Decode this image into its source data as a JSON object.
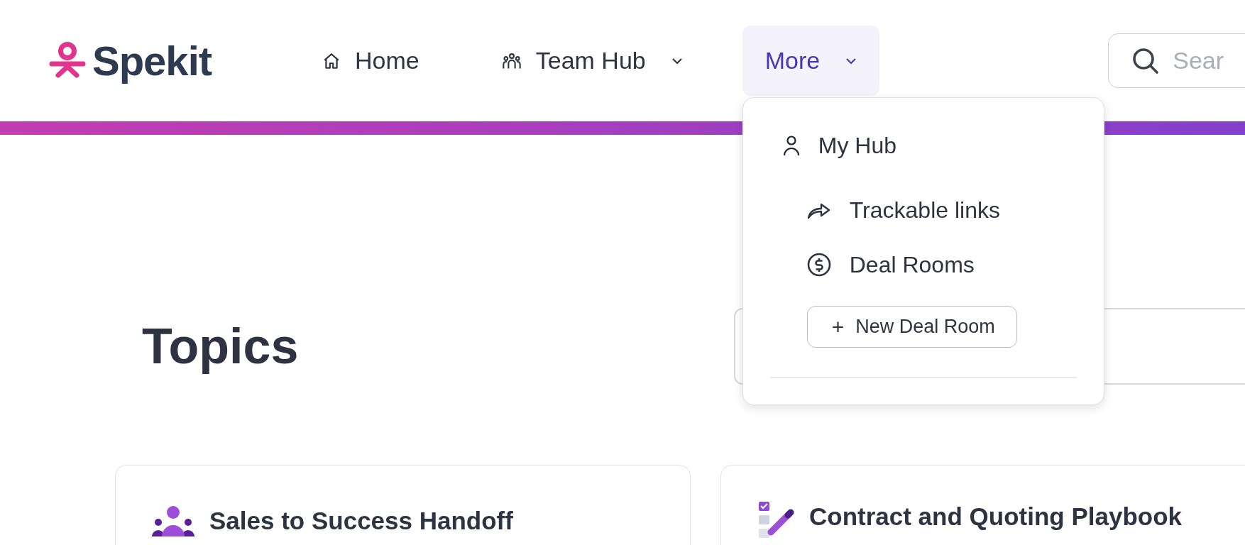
{
  "logo": {
    "text": "Spekit"
  },
  "nav": [
    {
      "label": "Home",
      "kind": "home",
      "selected": false,
      "dropdown": false
    },
    {
      "label": "Team Hub",
      "kind": "team",
      "selected": false,
      "dropdown": true
    },
    {
      "label": "More",
      "kind": "plain",
      "selected": true,
      "dropdown": true
    }
  ],
  "search": {
    "placeholder": "Sear"
  },
  "menu": {
    "items": [
      {
        "label": "My Hub",
        "kind": "person",
        "children": [
          {
            "label": "Trackable links",
            "kind": "share"
          },
          {
            "label": "Deal Rooms",
            "kind": "dollar"
          }
        ]
      }
    ],
    "button": {
      "icon_text": "+",
      "label": "New Deal Room"
    }
  },
  "page": {
    "title": "Topics"
  },
  "topics": [
    {
      "title": "Sales to Success Handoff",
      "kind": "team"
    },
    {
      "title": "Contract and Quoting Playbook",
      "kind": "checklist"
    }
  ]
}
